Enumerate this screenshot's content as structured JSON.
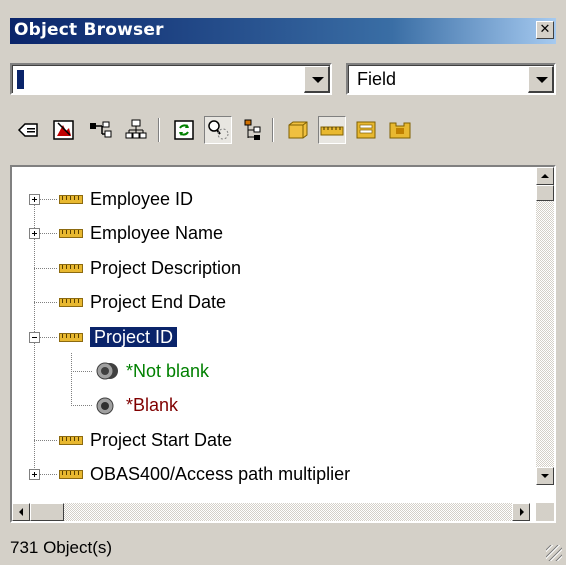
{
  "window": {
    "title": "Object Browser",
    "close_glyph": "✕"
  },
  "filters": {
    "object_combo_value": "",
    "type_combo_value": "Field"
  },
  "toolbar": {
    "buttons": [
      {
        "icon": "tag-icon"
      },
      {
        "icon": "picture-icon"
      },
      {
        "icon": "network-icon"
      },
      {
        "icon": "hierarchy-icon"
      },
      {
        "icon": "refresh-icon"
      },
      {
        "icon": "find-related-icon",
        "pressed": true
      },
      {
        "icon": "tree-link-icon"
      },
      {
        "icon": "file-icon"
      },
      {
        "icon": "field-icon",
        "pressed": true
      },
      {
        "icon": "record-icon"
      },
      {
        "icon": "library-icon"
      }
    ]
  },
  "tree": {
    "items": [
      {
        "label": "Employee ID",
        "expander": "plus",
        "icon": "field-icon"
      },
      {
        "label": "Employee Name",
        "expander": "plus",
        "icon": "field-icon"
      },
      {
        "label": "Project Description",
        "expander": "none",
        "icon": "field-icon"
      },
      {
        "label": "Project End Date",
        "expander": "none",
        "icon": "field-icon"
      },
      {
        "label": "Project ID",
        "expander": "minus",
        "icon": "field-icon",
        "selected": true
      },
      {
        "label": "*Not blank",
        "child": true,
        "icon": "condition-true-icon",
        "color": "#008000"
      },
      {
        "label": "*Blank",
        "child": true,
        "icon": "condition-icon",
        "color": "#800000"
      },
      {
        "label": "Project Start Date",
        "expander": "none",
        "icon": "field-icon"
      },
      {
        "label": "OBAS400/Access path multiplier",
        "expander": "plus",
        "icon": "field-icon"
      }
    ]
  },
  "status": {
    "text": "731 Object(s)"
  }
}
